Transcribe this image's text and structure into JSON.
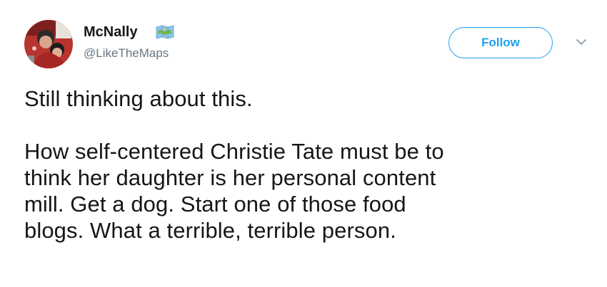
{
  "tweet": {
    "display_name": "McNally",
    "handle": "@LikeTheMaps",
    "follow_label": "Follow",
    "badge_icon": "map-icon",
    "menu_icon": "chevron-down-icon",
    "accent_color": "#1da1f2",
    "text": {
      "paragraph1": "Still thinking about this.",
      "paragraph2_lines": [
        "How self-centered Christie Tate must be to",
        "think her daughter is her personal content",
        "mill. Get a dog. Start one of those food",
        "blogs. What a terrible, terrible person."
      ]
    }
  }
}
